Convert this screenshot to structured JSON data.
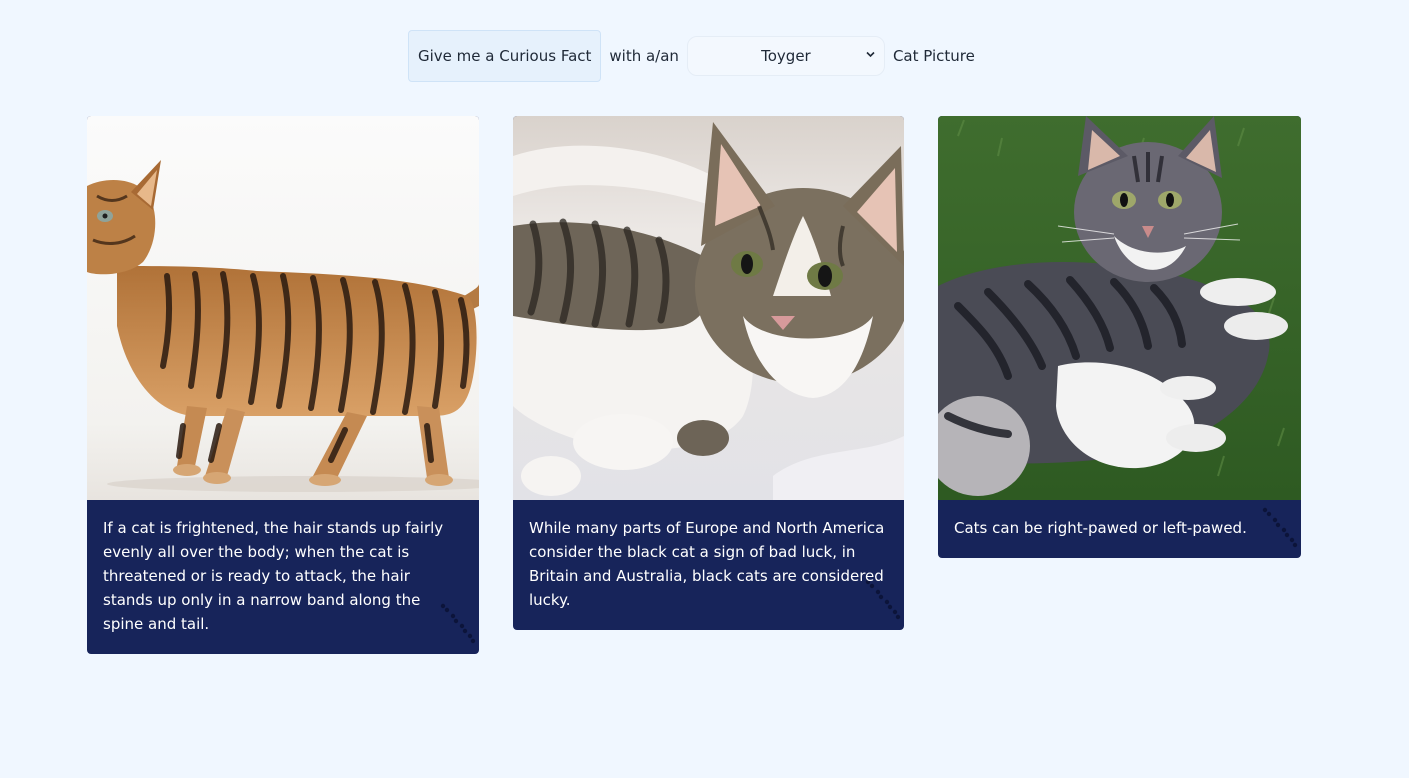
{
  "controls": {
    "fact_button_label": "Give me a Curious Fact",
    "with_label": "with a/an",
    "breed_selected": "Toyger",
    "picture_label": "Cat Picture"
  },
  "cards": [
    {
      "photo": "toyger-cat-walking",
      "fact": "If a cat is frightened, the hair stands up fairly evenly all over the body; when the cat is threatened or is ready to attack, the hair stands up only in a narrow band along the spine and tail."
    },
    {
      "photo": "tabby-white-kitten-on-blanket",
      "fact": "While many parts of Europe and North America consider the black cat a sign of bad luck, in Britain and Australia, black cats are considered lucky."
    },
    {
      "photo": "tabby-white-cat-on-grass",
      "fact": "Cats can be right-pawed or left-pawed."
    }
  ],
  "colors": {
    "page_background": "#f0f7ff",
    "card_background": "#17245a",
    "card_text": "#ffffff",
    "button_background": "#e6f1fc"
  }
}
